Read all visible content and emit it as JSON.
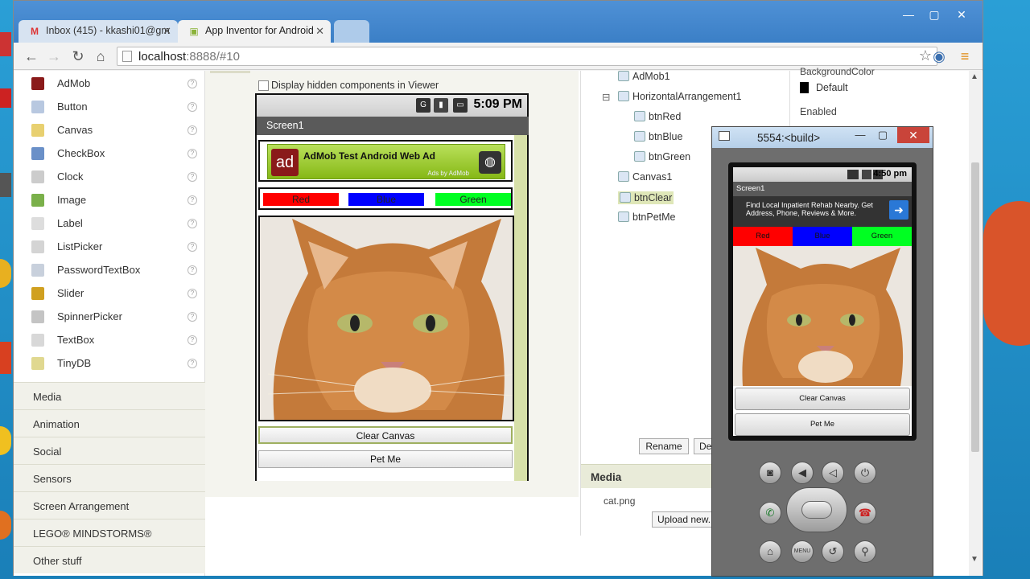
{
  "browser": {
    "tabs": [
      {
        "label": "Inbox (415) - kkashi01@gm",
        "icon": "gmail-icon",
        "active": false
      },
      {
        "label": "App Inventor for Android",
        "icon": "app-inventor-icon",
        "active": true
      }
    ],
    "url_host": "localhost",
    "url_rest": ":8888/#10"
  },
  "palette": {
    "items": [
      {
        "label": "AdMob",
        "icon": "admob-icon",
        "color": "#8a1a1a"
      },
      {
        "label": "Button",
        "icon": "button-icon",
        "color": "#b8c8e0"
      },
      {
        "label": "Canvas",
        "icon": "canvas-icon",
        "color": "#e8d070"
      },
      {
        "label": "CheckBox",
        "icon": "checkbox-icon",
        "color": "#6a90c8"
      },
      {
        "label": "Clock",
        "icon": "clock-icon",
        "color": "#cccccc"
      },
      {
        "label": "Image",
        "icon": "image-icon",
        "color": "#7ab04a"
      },
      {
        "label": "Label",
        "icon": "label-icon",
        "color": "#dddddd"
      },
      {
        "label": "ListPicker",
        "icon": "listpicker-icon",
        "color": "#d4d4d4"
      },
      {
        "label": "PasswordTextBox",
        "icon": "password-icon",
        "color": "#c8d0dc"
      },
      {
        "label": "Slider",
        "icon": "slider-icon",
        "color": "#d0a020"
      },
      {
        "label": "SpinnerPicker",
        "icon": "spinner-icon",
        "color": "#c4c4c4"
      },
      {
        "label": "TextBox",
        "icon": "textbox-icon",
        "color": "#d8d8d8"
      },
      {
        "label": "TinyDB",
        "icon": "tinydb-icon",
        "color": "#e0d890"
      }
    ],
    "help_glyph": "?",
    "categories": [
      "Media",
      "Animation",
      "Social",
      "Sensors",
      "Screen Arrangement",
      "LEGO® MINDSTORMS®",
      "Other stuff"
    ]
  },
  "viewer": {
    "hidden_label": "Display hidden components in Viewer",
    "time": "5:09 PM",
    "screen_title": "Screen1",
    "ad_title": "AdMob Test Android Web Ad",
    "ad_by": "Ads by AdMob",
    "ad_logo": "ad",
    "color_buttons": [
      {
        "label": "Red",
        "color": "#ff0000"
      },
      {
        "label": "Blue",
        "color": "#0000ff"
      },
      {
        "label": "Green",
        "color": "#00ff22"
      }
    ],
    "btn_clear": "Clear Canvas",
    "btn_pet": "Pet Me"
  },
  "components": {
    "tree": [
      {
        "label": "AdMob1",
        "indent": 0,
        "icon": "admob-icon"
      },
      {
        "label": "HorizontalArrangement1",
        "indent": 0,
        "icon": "arrangement-icon",
        "toggle": "⊟"
      },
      {
        "label": "btnRed",
        "indent": 1,
        "icon": "button-icon"
      },
      {
        "label": "btnBlue",
        "indent": 1,
        "icon": "button-icon"
      },
      {
        "label": "btnGreen",
        "indent": 1,
        "icon": "button-icon"
      },
      {
        "label": "Canvas1",
        "indent": 0,
        "icon": "canvas-icon"
      },
      {
        "label": "btnClear",
        "indent": 0,
        "icon": "button-icon",
        "selected": true
      },
      {
        "label": "btnPetMe",
        "indent": 0,
        "icon": "button-icon"
      }
    ],
    "rename": "Rename",
    "delete": "De",
    "media_header": "Media",
    "media_file": "cat.png",
    "upload": "Upload new..."
  },
  "properties": {
    "bg_color_label": "BackgroundColor",
    "bg_color_value": "Default",
    "enabled_label": "Enabled"
  },
  "emulator": {
    "title": "5554:<build>",
    "time": "4:50 pm",
    "screen_title": "Screen1",
    "ad_text": "Find Local Inpatient Rehab Nearby. Get Address, Phone, Reviews & More.",
    "color_buttons": [
      {
        "label": "Red",
        "color": "#ff0000"
      },
      {
        "label": "Blue",
        "color": "#0000ff"
      },
      {
        "label": "Green",
        "color": "#00ff22"
      }
    ],
    "btn_clear": "Clear Canvas",
    "btn_pet": "Pet Me",
    "menu_label": "MENU"
  }
}
